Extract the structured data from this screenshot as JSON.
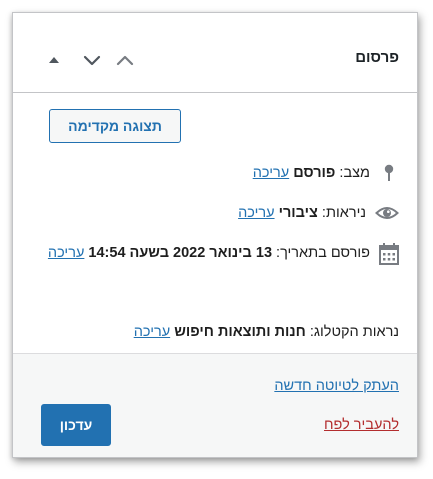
{
  "panel": {
    "title": "פרסום",
    "controls": {
      "collapse_icon": "chevron-up-icon",
      "expand_icon": "chevron-down-icon",
      "move_icon": "triangle-up-icon"
    }
  },
  "preview_button": {
    "label": "תצוגה מקדימה"
  },
  "status": {
    "icon": "pin-icon",
    "label": "מצב:",
    "value": "פורסם",
    "edit": "עריכה"
  },
  "visibility": {
    "icon": "eye-icon",
    "label": "ניראות:",
    "value": "ציבורי",
    "edit": "עריכה"
  },
  "published": {
    "icon": "calendar-icon",
    "label": "פורסם בתאריך:",
    "value": "13 בינואר 2022 בשעה 14:54",
    "edit": "עריכה"
  },
  "catalog": {
    "label": "נראות הקטלוג:",
    "value": "חנות ותוצאות חיפוש",
    "edit": "עריכה"
  },
  "footer": {
    "duplicate": "העתק לטיוטה חדשה",
    "trash": "להעביר לפח",
    "update_button": "עדכון"
  },
  "colors": {
    "accent": "#2271b1",
    "danger": "#b32d2e",
    "footer_bg": "#f6f7f7"
  }
}
